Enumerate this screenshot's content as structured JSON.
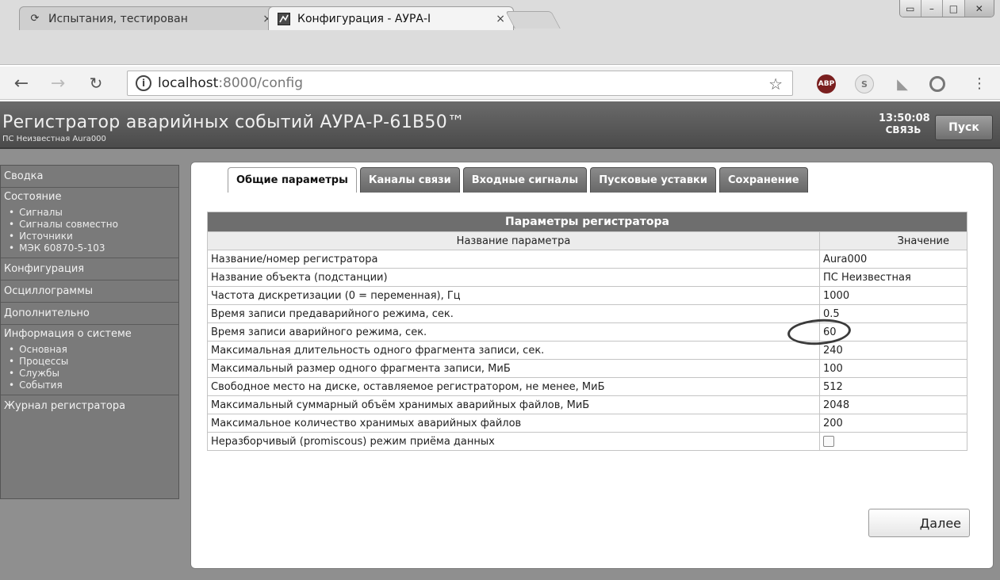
{
  "browser": {
    "tabs": [
      {
        "title": "Испытания, тестирован",
        "icon": "loading-spinner-icon",
        "active": false
      },
      {
        "title": "Конфигурация - АУРА-I",
        "icon": "app-favicon-icon",
        "active": true
      }
    ],
    "close_glyph": "×",
    "address": {
      "host": "localhost",
      "path": ":8000/config"
    },
    "window_controls": [
      "restore",
      "minimize",
      "maximize",
      "close"
    ],
    "extensions": [
      "ABP",
      "S",
      "rss",
      "eye"
    ]
  },
  "app": {
    "title": "Регистратор аварийных событий АУРА-Р-61В50™",
    "subtitle": "ПС Неизвестная Aura000",
    "clock": "13:50:08",
    "link_status": "СВЯЗЬ",
    "start_label": "Пуск"
  },
  "sidebar": {
    "summary": "Сводка",
    "state": {
      "label": "Состояние",
      "items": [
        "Сигналы",
        "Сигналы совместно",
        "Источники",
        "МЭК 60870-5-103"
      ]
    },
    "configuration": "Конфигурация",
    "oscillograms": "Осциллограммы",
    "additional": "Дополнительно",
    "system_info": {
      "label": "Информация о системе",
      "items": [
        "Основная",
        "Процессы",
        "Службы",
        "События"
      ]
    },
    "journal": "Журнал регистратора"
  },
  "tabs": [
    "Общие параметры",
    "Каналы связи",
    "Входные сигналы",
    "Пусковые уставки",
    "Сохранение"
  ],
  "table": {
    "caption": "Параметры регистратора",
    "header": {
      "name": "Название параметра",
      "value": "Значение"
    },
    "rows": [
      {
        "name": "Название/номер регистратора",
        "value": "Aura000"
      },
      {
        "name": "Название объекта (подстанции)",
        "value": "ПС Неизвестная"
      },
      {
        "name": "Частота дискретизации (0 = переменная), Гц",
        "value": "1000"
      },
      {
        "name": "Время записи предаварийного режима, сек.",
        "value": "0.5"
      },
      {
        "name": "Время записи аварийного режима, сек.",
        "value": "60"
      },
      {
        "name": "Максимальная длительность одного фрагмента записи, сек.",
        "value": "240"
      },
      {
        "name": "Максимальный размер одного фрагмента записи, МиБ",
        "value": "100"
      },
      {
        "name": "Свободное место на диске, оставляемое регистратором, не менее, МиБ",
        "value": "512"
      },
      {
        "name": "Максимальный суммарный объём хранимых аварийных файлов, МиБ",
        "value": "2048"
      },
      {
        "name": "Максимальное количество хранимых аварийных файлов",
        "value": "200"
      },
      {
        "name": "Неразборчивый (promiscous) режим приёма данных",
        "value": "",
        "checkbox": true,
        "checked": false
      }
    ]
  },
  "next_label": "Далее"
}
